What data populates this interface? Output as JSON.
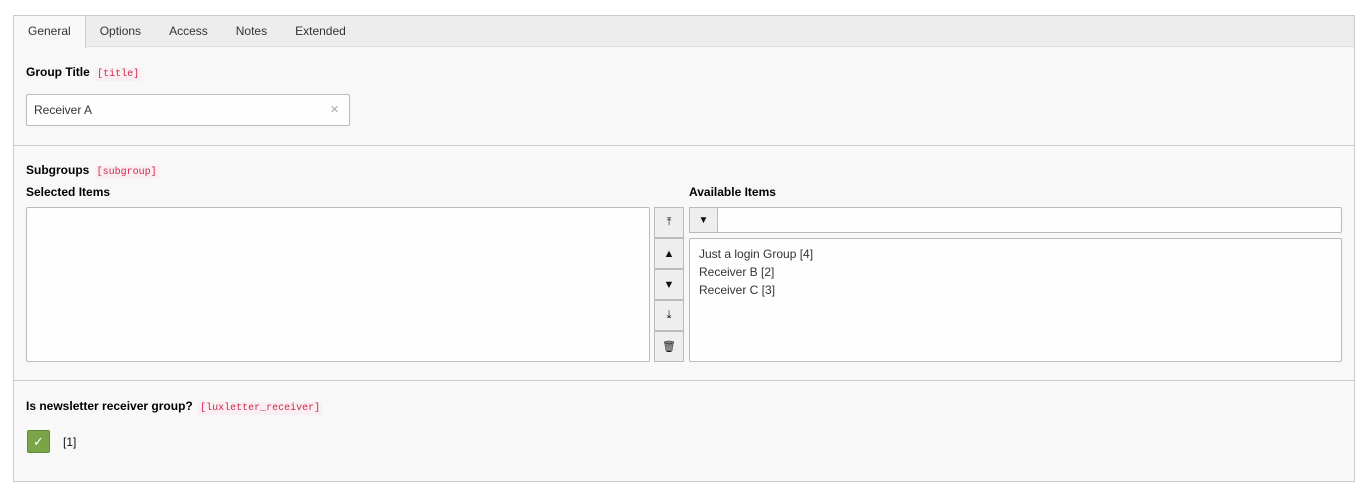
{
  "tabs": [
    "General",
    "Options",
    "Access",
    "Notes",
    "Extended"
  ],
  "title_field": {
    "label": "Group Title",
    "code": "[title]",
    "value": "Receiver A",
    "clear_icon": "×"
  },
  "subgroups": {
    "label": "Subgroups",
    "code": "[subgroup]",
    "selected_label": "Selected Items",
    "available_label": "Available Items",
    "available_items": [
      "Just a login Group [4]",
      "Receiver B [2]",
      "Receiver C [3]"
    ],
    "filter_value": ""
  },
  "receiver": {
    "label": "Is newsletter receiver group?",
    "code": "[luxletter_receiver]",
    "checked": true,
    "value_label": "[1]",
    "checkbox_color": "#79a548"
  }
}
